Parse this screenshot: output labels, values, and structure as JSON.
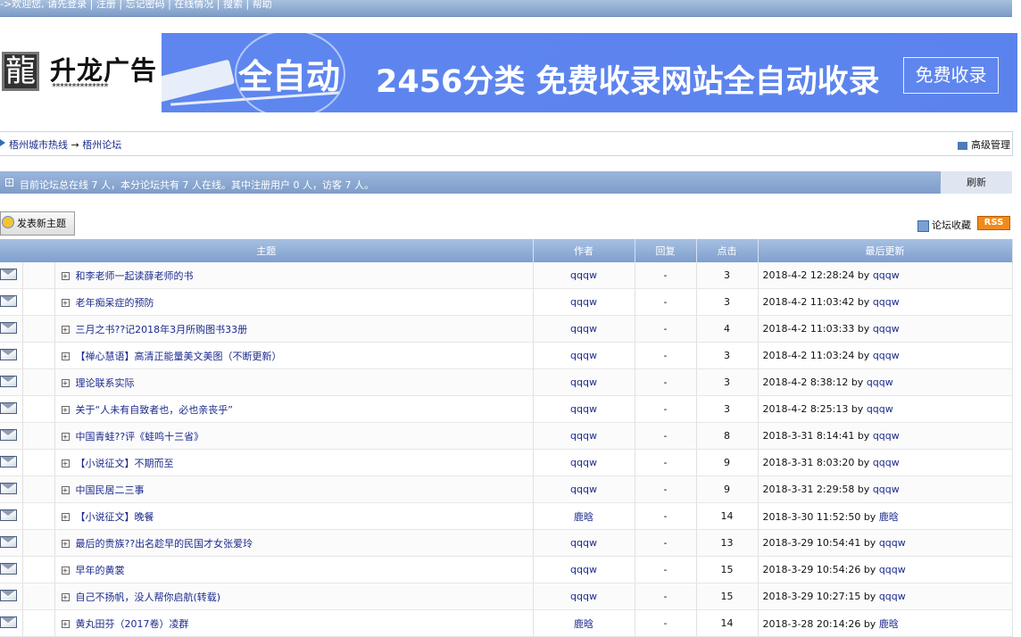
{
  "top_bar": {
    "welcome": "->欢迎您, 请先登录",
    "links": [
      "注册",
      "忘记密码",
      "在线情况",
      "搜索",
      "帮助"
    ]
  },
  "logo": {
    "char": "龍",
    "name": "升龙广告",
    "stars": "**************"
  },
  "banner": {
    "auto_text": "全自动",
    "slogan": "2456分类 免费收录网站全自动收录",
    "button": "免费收录"
  },
  "breadcrumb": {
    "home": "梧州城市热线",
    "arrow": "→",
    "forum": "梧州论坛",
    "admin_link": "高级管理"
  },
  "online_status": {
    "text": "目前论坛总在线 7 人，本分论坛共有 7 人在线。其中注册用户 0 人，访客 7 人。",
    "refresh": "刷新"
  },
  "toolbar": {
    "new_topic": "发表新主题",
    "favorite": "论坛收藏",
    "rss": "RSS"
  },
  "table": {
    "headers": {
      "title": "主题",
      "author": "作者",
      "replies": "回复",
      "clicks": "点击",
      "last_update": "最后更新"
    },
    "rows": [
      {
        "title": "和李老师一起读薛老师的书",
        "author": "qqqw",
        "replies": "-",
        "clicks": "3",
        "last_update": "2018-4-2 12:28:24 by",
        "last_user": "qqqw"
      },
      {
        "title": "老年痴呆症的预防",
        "author": "qqqw",
        "replies": "-",
        "clicks": "3",
        "last_update": "2018-4-2 11:03:42 by",
        "last_user": "qqqw"
      },
      {
        "title": "三月之书??记2018年3月所购图书33册",
        "author": "qqqw",
        "replies": "-",
        "clicks": "4",
        "last_update": "2018-4-2 11:03:33 by",
        "last_user": "qqqw"
      },
      {
        "title": "【禅心慧语】高清正能量美文美图（不断更新）",
        "author": "qqqw",
        "replies": "-",
        "clicks": "3",
        "last_update": "2018-4-2 11:03:24 by",
        "last_user": "qqqw"
      },
      {
        "title": "理论联系实际",
        "author": "qqqw",
        "replies": "-",
        "clicks": "3",
        "last_update": "2018-4-2 8:38:12 by",
        "last_user": "qqqw"
      },
      {
        "title": "关于“人未有自致者也，必也亲丧乎”",
        "author": "qqqw",
        "replies": "-",
        "clicks": "3",
        "last_update": "2018-4-2 8:25:13 by",
        "last_user": "qqqw"
      },
      {
        "title": "中国青蛙??评《蛙鸣十三省》",
        "author": "qqqw",
        "replies": "-",
        "clicks": "8",
        "last_update": "2018-3-31 8:14:41 by",
        "last_user": "qqqw"
      },
      {
        "title": "【小说征文】不期而至",
        "author": "qqqw",
        "replies": "-",
        "clicks": "9",
        "last_update": "2018-3-31 8:03:20 by",
        "last_user": "qqqw"
      },
      {
        "title": "中国民居二三事",
        "author": "qqqw",
        "replies": "-",
        "clicks": "9",
        "last_update": "2018-3-31 2:29:58 by",
        "last_user": "qqqw"
      },
      {
        "title": "【小说征文】晚餐",
        "author": "鹿晗",
        "replies": "-",
        "clicks": "14",
        "last_update": "2018-3-30 11:52:50 by",
        "last_user": "鹿晗"
      },
      {
        "title": "最后的贵族??出名趁早的民国才女张爱玲",
        "author": "qqqw",
        "replies": "-",
        "clicks": "13",
        "last_update": "2018-3-29 10:54:41 by",
        "last_user": "qqqw"
      },
      {
        "title": "早年的黄裳",
        "author": "qqqw",
        "replies": "-",
        "clicks": "15",
        "last_update": "2018-3-29 10:54:26 by",
        "last_user": "qqqw"
      },
      {
        "title": "自己不扬帆，没人帮你启航(转载)",
        "author": "qqqw",
        "replies": "-",
        "clicks": "15",
        "last_update": "2018-3-29 10:27:15 by",
        "last_user": "qqqw"
      },
      {
        "title": "黄丸田芬（2017卷）凌群",
        "author": "鹿晗",
        "replies": "-",
        "clicks": "14",
        "last_update": "2018-3-28 20:14:26 by",
        "last_user": "鹿晗"
      }
    ]
  }
}
